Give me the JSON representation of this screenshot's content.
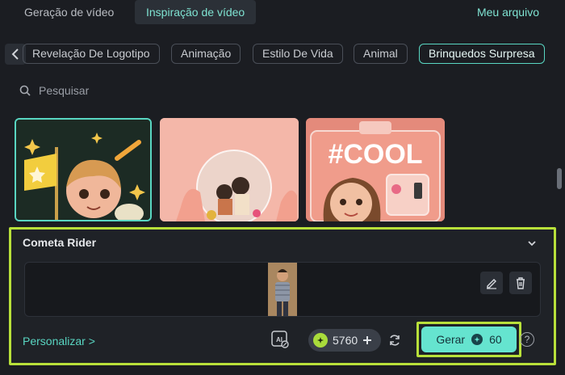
{
  "top_tabs": {
    "video_generation": "Geração de vídeo",
    "video_inspiration": "Inspiração de vídeo",
    "my_file": "Meu arquivo"
  },
  "categories": [
    "Revelação De Logotipo",
    "Animação",
    "Estilo De Vida",
    "Animal",
    "Brinquedos Surpresa"
  ],
  "active_category": "Brinquedos Surpresa",
  "search": {
    "placeholder": "Pesquisar"
  },
  "thumbnails": [
    {
      "label": ""
    },
    {
      "label": ""
    },
    {
      "label": "#COOL"
    }
  ],
  "panel": {
    "title": "Cometa Rider",
    "customize_label": "Personalizar >",
    "credits": "5760",
    "generate_label": "Gerar",
    "generate_cost": "60",
    "help_label": "?"
  },
  "colors": {
    "accent": "#59d6c2",
    "highlight_border": "#b8e03a",
    "background": "#1b1d22"
  }
}
